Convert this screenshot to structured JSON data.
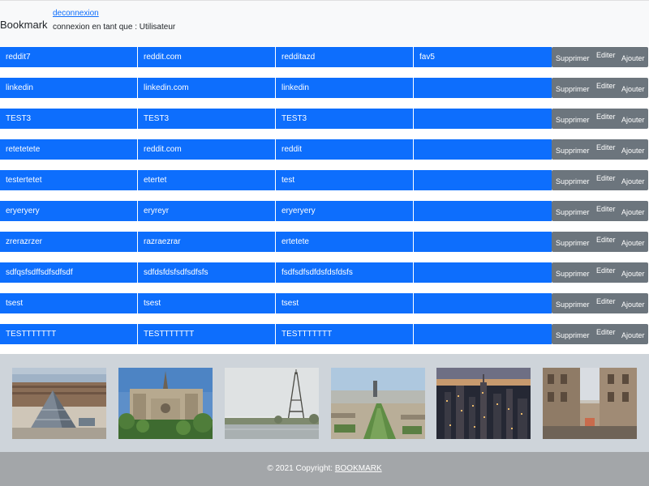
{
  "header": {
    "brand": "Bookmark",
    "logout_link": "deconnexion",
    "status": "connexion en tant que : Utilisateur"
  },
  "actions": {
    "delete": "Supprimer",
    "edit": "Editer",
    "add": "Ajouter"
  },
  "bookmarks": [
    {
      "c1": "reddit7",
      "c2": " reddit.com",
      "c3": "redditazd",
      "c4": "fav5"
    },
    {
      "c1": "linkedin",
      "c2": "linkedin.com",
      "c3": "linkedin",
      "c4": ""
    },
    {
      "c1": "TEST3",
      "c2": "TEST3",
      "c3": "TEST3",
      "c4": ""
    },
    {
      "c1": "retetetete",
      "c2": " reddit.com",
      "c3": "reddit",
      "c4": ""
    },
    {
      "c1": "testertetet",
      "c2": "etertet",
      "c3": "test",
      "c4": ""
    },
    {
      "c1": "eryeryery",
      "c2": "eryreyr",
      "c3": "eryeryery",
      "c4": ""
    },
    {
      "c1": "zrerazrzer",
      "c2": "razraezrar",
      "c3": "ertetete",
      "c4": ""
    },
    {
      "c1": "sdfqsfsdffsdfsdfsdf",
      "c2": "sdfdsfdsfsdfsdfsfs",
      "c3": "fsdfsdfsdfdsfdsfdsfs",
      "c4": ""
    },
    {
      "c1": "tsest",
      "c2": "tsest",
      "c3": "tsest",
      "c4": ""
    },
    {
      "c1": "TESTTTTTTT",
      "c2": "TESTTTTTTT",
      "c3": "TESTTTTTTT",
      "c4": ""
    }
  ],
  "footer": {
    "copyright": "© 2021 Copyright: ",
    "link": "BOOKMARK"
  }
}
